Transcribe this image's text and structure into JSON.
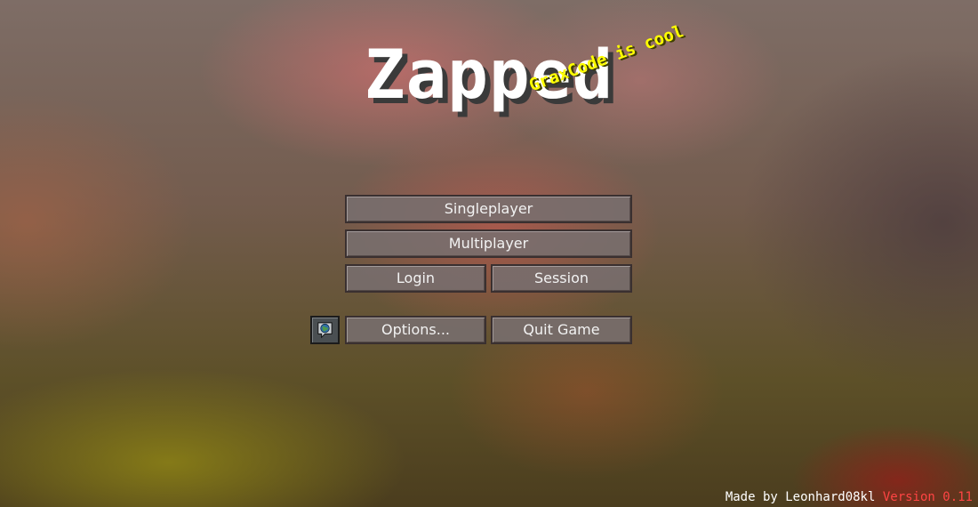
{
  "title": "Zapped",
  "splash": "GraxCode is cool",
  "menu": {
    "singleplayer": "Singleplayer",
    "multiplayer": "Multiplayer",
    "login": "Login",
    "session": "Session",
    "options": "Options...",
    "quit": "Quit Game"
  },
  "language_button": {
    "icon": "globe-speech-icon"
  },
  "footer": {
    "credit": "Made by Leonhard08kl",
    "version": "Version 0.11"
  },
  "colors": {
    "splash": "#ffff00",
    "version": "#ff4444",
    "button_text": "#f2f2f2"
  }
}
